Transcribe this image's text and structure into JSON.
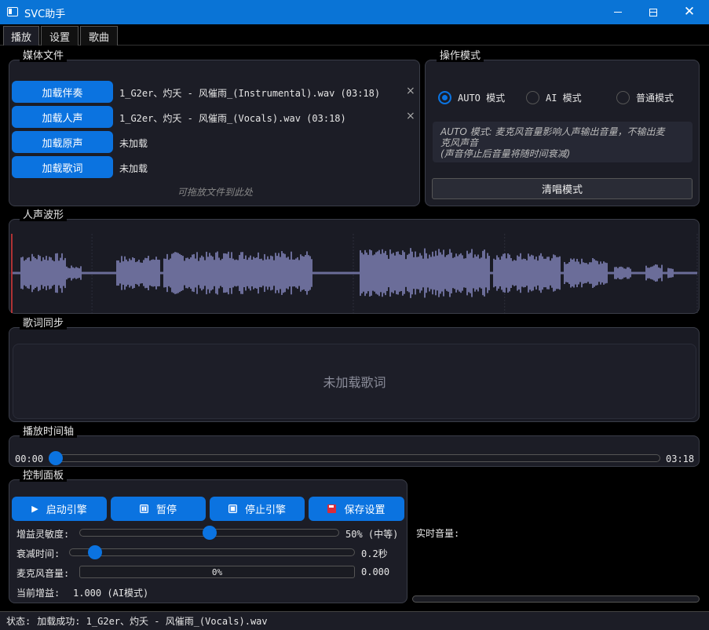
{
  "window": {
    "title": "SVC助手"
  },
  "tabs": [
    "播放",
    "设置",
    "歌曲"
  ],
  "media": {
    "title": "媒体文件",
    "rows": [
      {
        "button": "加载伴奏",
        "file": "1_G2er、灼夭 - 风催雨_(Instrumental).wav (03:18)",
        "clear": "×"
      },
      {
        "button": "加载人声",
        "file": "1_G2er、灼夭 - 风催雨_(Vocals).wav (03:18)",
        "clear": "×"
      },
      {
        "button": "加载原声",
        "file": "未加载",
        "clear": ""
      },
      {
        "button": "加载歌词",
        "file": "未加载",
        "clear": ""
      }
    ],
    "drop_hint": "可拖放文件到此处"
  },
  "mode": {
    "title": "操作模式",
    "options": [
      "AUTO 模式",
      "AI 模式",
      "普通模式"
    ],
    "selected": 0,
    "description_line1": "AUTO 模式: 麦克风音量影响人声输出音量，不输出麦",
    "description_line2": "克风声音",
    "description_line3": "(声音停止后音量将随时间衰减)",
    "acapella_button": "清唱模式"
  },
  "waveform": {
    "title": "人声波形"
  },
  "lyrics": {
    "title": "歌词同步",
    "placeholder": "未加载歌词"
  },
  "timeline": {
    "title": "播放时间轴",
    "current": "00:00",
    "total": "03:18",
    "progress": 0.0
  },
  "control": {
    "title": "控制面板",
    "buttons": {
      "start": "启动引擎",
      "pause": "暂停",
      "stop": "停止引擎",
      "save": "保存设置"
    },
    "gain_label": "增益灵敏度:",
    "gain_value": "50% (中等)",
    "gain_level": 0.5,
    "decay_label": "衰减时间:",
    "decay_value": "0.2秒",
    "decay_level": 0.07,
    "mic_label": "麦克风音量:",
    "mic_bar_text": "0%",
    "mic_value": "0.000",
    "current_gain_label": "当前增益:",
    "current_gain_value": "1.000 (AI模式)"
  },
  "realtime": {
    "label": "实时音量:"
  },
  "status": {
    "label": "状态:",
    "text": "加载成功: 1_G2er、灼夭 - 风催雨_(Vocals).wav"
  },
  "colors": {
    "accent": "#0b73e0",
    "titlebar": "#0a74d6",
    "wave": "#6b6d99",
    "playhead": "#e03a3a"
  }
}
